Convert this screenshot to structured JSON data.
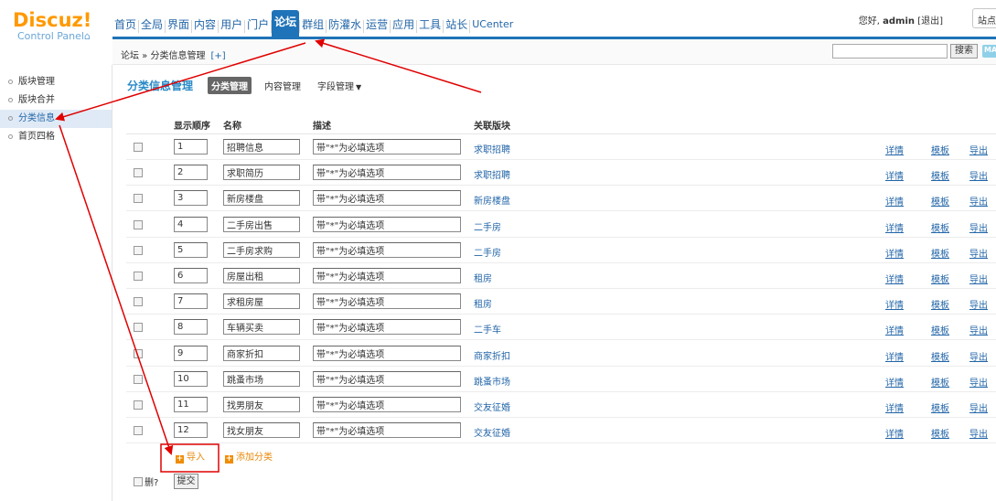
{
  "header": {
    "logo_text": "Discuz!",
    "logo_sub": "Control Panel",
    "nav": [
      "首页",
      "全局",
      "界面",
      "内容",
      "用户",
      "门户",
      "论坛",
      "群组",
      "防灌水",
      "运营",
      "应用",
      "工具",
      "站长",
      "UCenter"
    ],
    "active_nav": "论坛",
    "greeting": "您好,",
    "username": "admin",
    "logout": "[退出]",
    "site_home": "站点首页"
  },
  "crumbbar": {
    "path": "论坛 » 分类信息管理",
    "add": "[+]",
    "search_button": "搜索",
    "map_button": "MAP"
  },
  "sidebar": {
    "items": [
      "版块管理",
      "版块合并",
      "分类信息",
      "首页四格"
    ],
    "active": "分类信息"
  },
  "main": {
    "title": "分类信息管理",
    "tabs": [
      {
        "label": "分类管理",
        "active": true
      },
      {
        "label": "内容管理",
        "active": false
      },
      {
        "label": "字段管理",
        "active": false,
        "dropdown": "▼"
      }
    ],
    "columns": [
      "显示顺序",
      "名称",
      "描述",
      "关联版块"
    ],
    "row_links": [
      "详情",
      "模板",
      "导出"
    ],
    "rows": [
      {
        "order": "1",
        "name": "招聘信息",
        "desc": "带\"*\"为必填选项",
        "forum": "求职招聘"
      },
      {
        "order": "2",
        "name": "求职简历",
        "desc": "带\"*\"为必填选项",
        "forum": "求职招聘"
      },
      {
        "order": "3",
        "name": "新房楼盘",
        "desc": "带\"*\"为必填选项",
        "forum": "新房楼盘"
      },
      {
        "order": "4",
        "name": "二手房出售",
        "desc": "带\"*\"为必填选项",
        "forum": "二手房"
      },
      {
        "order": "5",
        "name": "二手房求购",
        "desc": "带\"*\"为必填选项",
        "forum": "二手房"
      },
      {
        "order": "6",
        "name": "房屋出租",
        "desc": "带\"*\"为必填选项",
        "forum": "租房"
      },
      {
        "order": "7",
        "name": "求租房屋",
        "desc": "带\"*\"为必填选项",
        "forum": "租房"
      },
      {
        "order": "8",
        "name": "车辆买卖",
        "desc": "带\"*\"为必填选项",
        "forum": "二手车"
      },
      {
        "order": "9",
        "name": "商家折扣",
        "desc": "带\"*\"为必填选项",
        "forum": "商家折扣"
      },
      {
        "order": "10",
        "name": "跳蚤市场",
        "desc": "带\"*\"为必填选项",
        "forum": "跳蚤市场"
      },
      {
        "order": "11",
        "name": "找男朋友",
        "desc": "带\"*\"为必填选项",
        "forum": "交友征婚"
      },
      {
        "order": "12",
        "name": "找女朋友",
        "desc": "带\"*\"为必填选项",
        "forum": "交友征婚"
      }
    ],
    "import_label": "导入",
    "add_label": "添加分类",
    "delete_label": "删?",
    "submit_label": "提交"
  },
  "colors": {
    "accent": "#1f73b8",
    "link": "#2366a8",
    "logo": "#ff9900",
    "orange_link": "#e8890b",
    "annotation": "#e00000"
  }
}
